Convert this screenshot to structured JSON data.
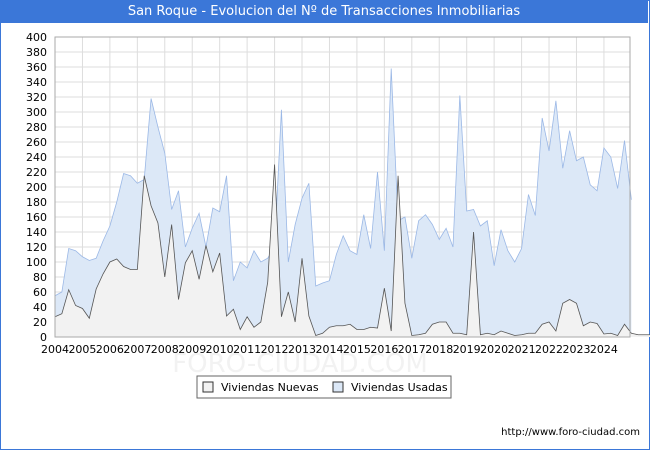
{
  "chart_data": {
    "type": "area",
    "title": "San Roque - Evolucion del Nº de Transacciones Inmobiliarias",
    "x_unit": "quarter",
    "start_year": 2004,
    "x_ticks": [
      "2004",
      "2005",
      "2006",
      "2007",
      "2008",
      "2009",
      "2010",
      "2011",
      "2012",
      "2013",
      "2014",
      "2015",
      "2016",
      "2017",
      "2018",
      "2019",
      "2020",
      "2021",
      "2022",
      "2023",
      "2024"
    ],
    "y_ticks": [
      0,
      20,
      40,
      60,
      80,
      100,
      120,
      140,
      160,
      180,
      200,
      220,
      240,
      260,
      280,
      300,
      320,
      340,
      360,
      380,
      400
    ],
    "ylim": [
      0,
      400
    ],
    "grid": true,
    "legend_position": "bottom",
    "series": [
      {
        "name": "Viviendas Nuevas",
        "color": "#f2f2f2",
        "stroke": "#555555",
        "values": [
          27,
          31,
          63,
          42,
          38,
          25,
          64,
          84,
          100,
          104,
          94,
          90,
          90,
          215,
          175,
          152,
          80,
          150,
          50,
          99,
          115,
          77,
          122,
          87,
          112,
          28,
          37,
          10,
          27,
          13,
          20,
          73,
          230,
          27,
          60,
          20,
          105,
          28,
          2,
          5,
          13,
          15,
          15,
          17,
          10,
          10,
          13,
          12,
          65,
          8,
          215,
          45,
          2,
          3,
          5,
          17,
          20,
          20,
          5,
          5,
          3,
          140,
          3,
          5,
          3,
          8,
          5,
          2,
          3,
          5,
          5,
          17,
          20,
          8,
          45,
          50,
          45,
          15,
          20,
          18,
          4,
          5,
          2,
          17,
          5,
          3,
          3,
          3
        ]
      },
      {
        "name": "Viviendas Usadas",
        "color": "#dce8f7",
        "stroke": "#9bb8e6",
        "values": [
          55,
          60,
          118,
          115,
          107,
          102,
          105,
          128,
          148,
          180,
          218,
          215,
          205,
          210,
          318,
          280,
          245,
          170,
          195,
          120,
          145,
          165,
          120,
          172,
          167,
          215,
          75,
          100,
          92,
          115,
          100,
          105,
          120,
          303,
          100,
          150,
          185,
          205,
          68,
          72,
          75,
          110,
          135,
          115,
          110,
          163,
          118,
          220,
          115,
          358,
          155,
          160,
          105,
          155,
          163,
          150,
          130,
          145,
          120,
          322,
          168,
          170,
          148,
          155,
          95,
          143,
          115,
          100,
          118,
          190,
          162,
          292,
          248,
          315,
          225,
          275,
          235,
          240,
          203,
          195,
          252,
          240,
          198,
          262,
          183
        ]
      }
    ]
  },
  "legend": {
    "items": [
      "Viviendas Nuevas",
      "Viviendas Usadas"
    ]
  },
  "footer": {
    "url": "http://www.foro-ciudad.com"
  },
  "watermark": "FORO-CIUDAD.COM"
}
